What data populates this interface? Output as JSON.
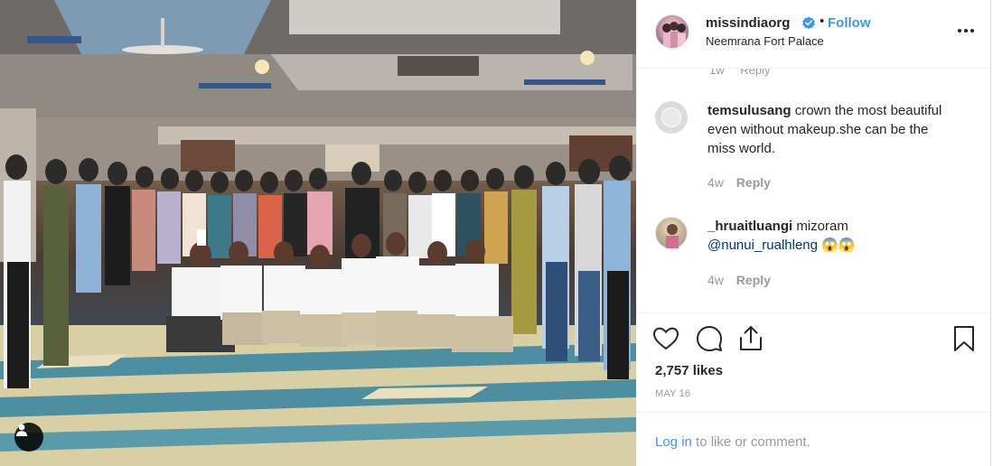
{
  "post": {
    "username": "missindiaorg",
    "separator": "•",
    "follow_label": "Follow",
    "location": "Neemrana Fort Palace",
    "verified": true,
    "more_icon": "more-horizontal-icon"
  },
  "comments": {
    "partial_row": {
      "time": "1w",
      "reply_label": "Reply"
    },
    "items": [
      {
        "username": "temsulusang",
        "text": "crown the most beautiful even without makeup.she can be the miss world.",
        "time": "4w",
        "reply_label": "Reply"
      },
      {
        "username": "_hruaitluangi",
        "text": "mizoram",
        "mention": "@nunui_rualhleng",
        "emoji": "😱😱",
        "time": "4w",
        "reply_label": "Reply"
      }
    ]
  },
  "actions": {
    "icons": [
      "heart-icon",
      "comment-icon",
      "share-icon",
      "bookmark-icon"
    ],
    "likes": "2,757 likes",
    "date": "MAY 16"
  },
  "login": {
    "link_label": "Log in",
    "rest_text": "to like or comment."
  },
  "colors": {
    "link_blue": "#3897f0",
    "text": "#262626",
    "muted": "#999999",
    "border": "#efefef"
  }
}
